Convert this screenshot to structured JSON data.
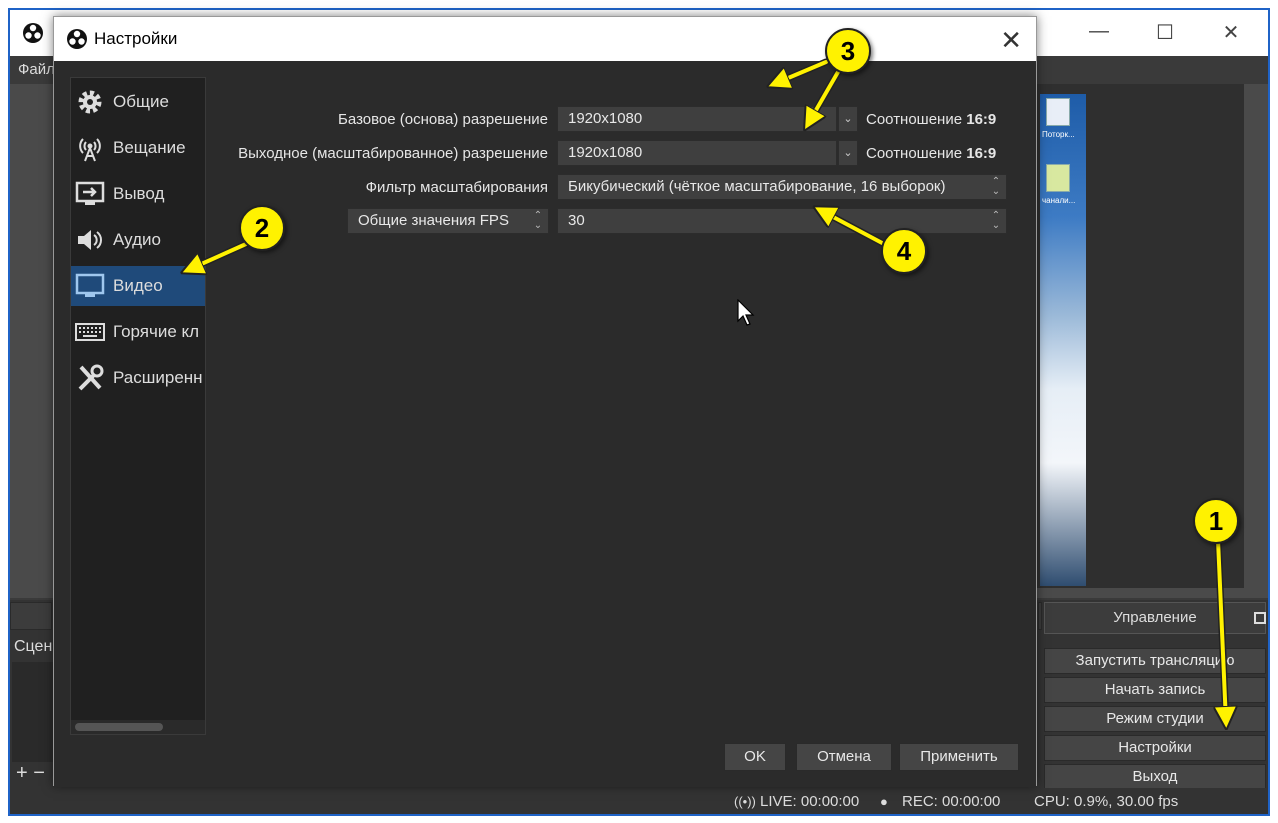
{
  "main_window": {
    "menu_file": "Файл",
    "scenes_label": "Сцен",
    "add_symbol": "+",
    "remove_symbol": "−",
    "controls": {
      "title": "Управление",
      "buttons": [
        "Запустить трансляцию",
        "Начать запись",
        "Режим студии",
        "Настройки",
        "Выход"
      ]
    },
    "status": {
      "live": "LIVE: 00:00:00",
      "rec": "REC: 00:00:00",
      "cpu": "CPU: 0.9%, 30.00 fps"
    },
    "desktop_labels": [
      "Поторк...",
      "чанали..."
    ]
  },
  "dialog": {
    "title": "Настройки",
    "sidebar": [
      {
        "label": "Общие",
        "icon": "gear-icon"
      },
      {
        "label": "Вещание",
        "icon": "broadcast-icon"
      },
      {
        "label": "Вывод",
        "icon": "output-icon"
      },
      {
        "label": "Аудио",
        "icon": "speaker-icon"
      },
      {
        "label": "Видео",
        "icon": "monitor-icon",
        "selected": true
      },
      {
        "label": "Горячие кл",
        "icon": "keyboard-icon"
      },
      {
        "label": "Расширенн",
        "icon": "tools-icon"
      }
    ],
    "video": {
      "base_resolution": {
        "label": "Базовое (основа) разрешение",
        "value": "1920x1080",
        "ratio_prefix": "Соотношение",
        "ratio": "16:9"
      },
      "output_resolution": {
        "label": "Выходное (масштабированное) разрешение",
        "value": "1920x1080",
        "ratio_prefix": "Соотношение",
        "ratio": "16:9"
      },
      "scale_filter": {
        "label": "Фильтр масштабирования",
        "value": "Бикубический (чёткое масштабирование, 16 выборок)"
      },
      "fps": {
        "type_label": "Общие значения FPS",
        "value": "30"
      }
    },
    "buttons": {
      "ok": "OK",
      "cancel": "Отмена",
      "apply": "Применить"
    }
  },
  "annotations": {
    "badges": [
      "1",
      "2",
      "3",
      "4"
    ],
    "color": "#fff200"
  }
}
